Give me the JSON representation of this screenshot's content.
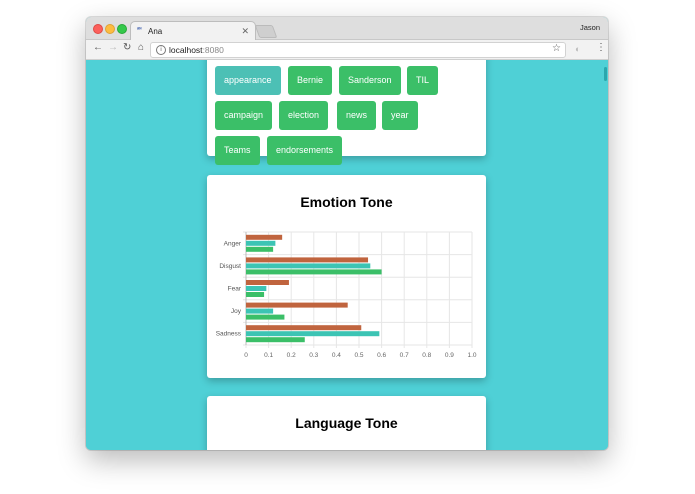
{
  "browser": {
    "tab_title": "Ana",
    "favicon_text": "ᵃᶰ",
    "profile_name": "Jason",
    "url_host": "localhost",
    "url_port": ":8080"
  },
  "tags": [
    "appearance",
    "Bernie",
    "Sanderson",
    "TIL",
    "campaign",
    "election",
    "news",
    "year",
    "Teams",
    "endorsements"
  ],
  "emotion_card": {
    "title": "Emotion Tone"
  },
  "language_card": {
    "title": "Language Tone"
  },
  "colors": {
    "series_a": "#c0643e",
    "series_b": "#3cc4b4",
    "series_c": "#3bbf68",
    "tag": "#3bbf68",
    "tag_active": "#4cc0b5"
  },
  "chart_data": {
    "type": "bar",
    "orientation": "horizontal",
    "categories": [
      "Anger",
      "Disgust",
      "Fear",
      "Joy",
      "Sadness"
    ],
    "series": [
      {
        "values": [
          0.16,
          0.54,
          0.19,
          0.45,
          0.51
        ]
      },
      {
        "values": [
          0.13,
          0.55,
          0.09,
          0.12,
          0.59
        ]
      },
      {
        "values": [
          0.12,
          0.6,
          0.08,
          0.17,
          0.26
        ]
      }
    ],
    "xlim": [
      0,
      1.0
    ],
    "xticks": [
      "0",
      "0.1",
      "0.2",
      "0.3",
      "0.4",
      "0.5",
      "0.6",
      "0.7",
      "0.8",
      "0.9",
      "1.0"
    ],
    "grid": true
  }
}
